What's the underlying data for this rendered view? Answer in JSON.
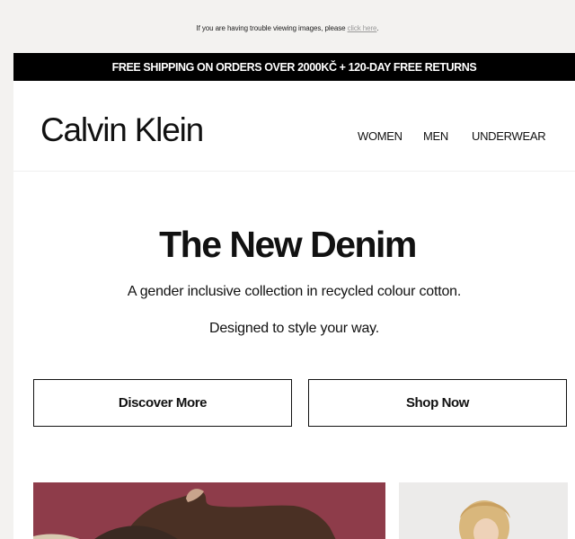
{
  "preheader": {
    "text": "If you are having trouble viewing images, please ",
    "link": "click here"
  },
  "promo": {
    "text": "FREE SHIPPING ON ORDERS OVER 2000KČ + 120-DAY FREE RETURNS"
  },
  "header": {
    "logo": "Calvin Klein",
    "nav": [
      "WOMEN",
      "MEN",
      "UNDERWEAR"
    ]
  },
  "hero": {
    "title": "The New Denim",
    "subtitle": "A gender inclusive collection in recycled colour cotton.",
    "subtitle2": "Designed to style your way."
  },
  "buttons": {
    "discover": "Discover More",
    "shop": "Shop Now"
  },
  "colors": {
    "promo_bar": "#000000",
    "image_left_bg": "#8e3c4a",
    "image_right_bg": "#ecebea"
  }
}
